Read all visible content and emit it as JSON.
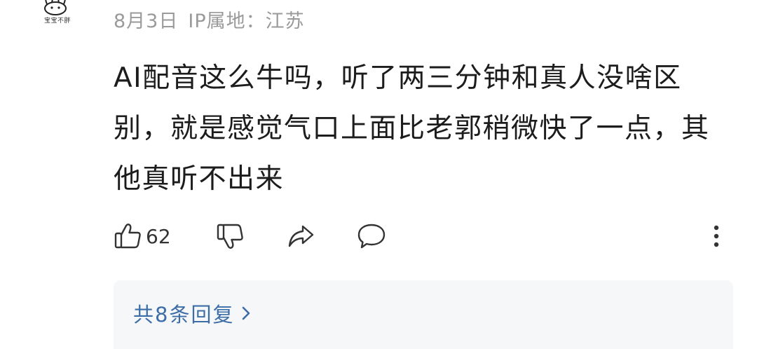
{
  "user": {
    "name": "宝宝不胖",
    "avatar_icon": "bunny-avatar-icon"
  },
  "meta": {
    "date": "8月3日",
    "ip_label": "IP属地：江苏"
  },
  "comment": {
    "text": "AI配音这么牛吗，听了两三分钟和真人没啥区别，就是感觉气口上面比老郭稍微快了一点，其他真听不出来"
  },
  "actions": {
    "like_icon": "thumbs-up-icon",
    "like_count": "62",
    "dislike_icon": "thumbs-down-icon",
    "share_icon": "share-arrow-icon",
    "comment_icon": "speech-bubble-icon",
    "more_icon": "more-vertical-icon"
  },
  "replies": {
    "label": "共8条回复",
    "chevron_icon": "chevron-right-icon"
  },
  "colors": {
    "text_primary": "#1c1c1c",
    "text_meta": "#9a9a9a",
    "icon": "#333333",
    "reply_link": "#3d6da7",
    "reply_bg": "#f6f7f9"
  }
}
